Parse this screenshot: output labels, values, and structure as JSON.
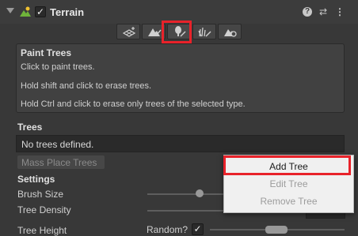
{
  "component": {
    "title": "Terrain",
    "enabled": true,
    "icons": [
      "terrain-icon",
      "help-icon",
      "preset-icon",
      "more-icon"
    ]
  },
  "toolbar": {
    "tools": [
      {
        "name": "create-neighbor-terrains-tool"
      },
      {
        "name": "paint-terrain-tool"
      },
      {
        "name": "paint-trees-tool",
        "active": true
      },
      {
        "name": "paint-details-tool"
      },
      {
        "name": "terrain-settings-tool"
      }
    ]
  },
  "info": {
    "title": "Paint Trees",
    "line1": "Click to paint trees.",
    "line2": "Hold shift and click to erase trees.",
    "line3": "Hold Ctrl and click to erase only trees of the selected type."
  },
  "trees": {
    "label": "Trees",
    "empty_text": "No trees defined.",
    "mass_place_label": "Mass Place Trees"
  },
  "settings": {
    "label": "Settings",
    "brush_size_label": "Brush Size",
    "tree_density_label": "Tree Density",
    "tree_height_label": "Tree Height",
    "random_label": "Random?",
    "random_checked": true
  },
  "menu": {
    "add_tree": "Add Tree",
    "edit_tree": "Edit Tree",
    "remove_tree": "Remove Tree"
  },
  "colors": {
    "highlight": "#e8222a",
    "panel_bg": "#383838"
  }
}
